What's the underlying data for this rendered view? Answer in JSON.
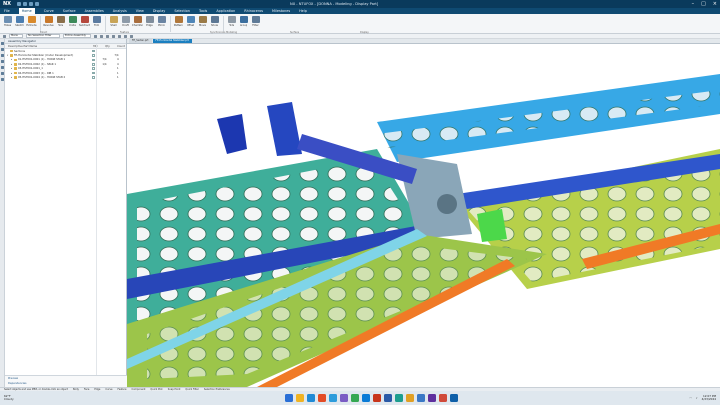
{
  "titlebar": {
    "logo": "NX",
    "title": "NX - NTUFOX - [DONNA - Modeling - Display Part]"
  },
  "menu": [
    "File",
    "Home",
    "Curve",
    "Surface",
    "Assemblies",
    "Analysis",
    "View",
    "Display",
    "Selection",
    "Tools",
    "Application",
    "Rhinoceros",
    "Milestones",
    "Help"
  ],
  "ribbon": {
    "buttons": [
      {
        "label": "Holes",
        "color": "#6c8fb3"
      },
      {
        "label": "Sketch",
        "color": "#4a7db0"
      },
      {
        "label": "Extrude",
        "color": "#d98a2b"
      },
      {
        "label": "Revolve",
        "color": "#c9782a"
      },
      {
        "label": "Hole",
        "color": "#8a6f4b"
      },
      {
        "label": "Unite",
        "color": "#3d8a5a"
      },
      {
        "label": "Subtract",
        "color": "#b5483d"
      },
      {
        "label": "Trim",
        "color": "#5a7aa0"
      },
      {
        "label": "Shell",
        "color": "#c8a456"
      },
      {
        "label": "Draft",
        "color": "#8d9aa8"
      },
      {
        "label": "Chamfer",
        "color": "#a86d3d"
      },
      {
        "label": "Edge",
        "color": "#7f8d9c"
      },
      {
        "label": "Mirror",
        "color": "#6a84a2"
      },
      {
        "label": "Pattern",
        "color": "#b0773a"
      },
      {
        "label": "Offset",
        "color": "#4f86b8"
      },
      {
        "label": "Move",
        "color": "#9a7a46"
      },
      {
        "label": "Show",
        "color": "#5c7794"
      },
      {
        "label": "Hide",
        "color": "#8c98a4"
      },
      {
        "label": "Group",
        "color": "#3b6e9e"
      },
      {
        "label": "Filter",
        "color": "#5e7a97"
      }
    ],
    "groups": [
      "Direct",
      "Feature",
      "Synchronous Modeling",
      "Surface",
      "Display"
    ]
  },
  "cmdbar": {
    "menu_label": "Menu",
    "filter_value": "No Selection Filter",
    "scope_value": "Entire Assembly"
  },
  "tabs": [
    {
      "label": "FE_Sedan.prt",
      "active": false
    },
    {
      "label": "FE-Horizontal Stabilizer.prt",
      "active": true
    }
  ],
  "navigator": {
    "title": "Assembly Navigator",
    "columns": [
      "Descriptive Part Name",
      "MO",
      "Qty",
      "Count"
    ],
    "rows": [
      {
        "label": "Sections",
        "indent": 0,
        "arrow": "",
        "qty": "",
        "count": ""
      },
      {
        "label": "FE-Horizontal Stabilizer (Under Development)",
        "indent": 0,
        "arrow": "▾",
        "qty": "",
        "count": "7/4"
      },
      {
        "label": "01-HST001-0001 (1) - HORIZ STAB 1",
        "indent": 1,
        "arrow": "▸",
        "qty": "7/4",
        "count": "4"
      },
      {
        "label": "02-HST001-0002 (1) - SPAR 1",
        "indent": 1,
        "arrow": "▸",
        "qty": "1/4",
        "count": "4"
      },
      {
        "label": "03-HST001-0001_1",
        "indent": 1,
        "arrow": "▸",
        "qty": "",
        "count": "1"
      },
      {
        "label": "04-HST001-0003 (1) - RIB 1",
        "indent": 1,
        "arrow": "▸",
        "qty": "",
        "count": "1"
      },
      {
        "label": "05-HST001-0004 (1) - HORIZ STAB 2",
        "indent": 1,
        "arrow": "▸",
        "qty": "",
        "count": "1"
      }
    ],
    "bottom": [
      "Preview",
      "Dependencies"
    ]
  },
  "status": [
    "Select objects and use MB3, or double-click an object",
    "Body",
    "Face",
    "Edge",
    "Curve",
    "Feature",
    "Component",
    "Quick Pick",
    "Snap Point",
    "Quick Filter",
    "Selection Preferences"
  ],
  "taskbar": {
    "temp": "62°F",
    "weather": "Cloudy",
    "time": "12:07 PM",
    "date": "4/23/2024",
    "apps": [
      "#2a6fd6",
      "#f0b323",
      "#1f8ad6",
      "#e34c26",
      "#2d9cdb",
      "#7a5cc4",
      "#35a853",
      "#0a7bd6",
      "#c8351b",
      "#2a5aa7",
      "#1d9e8f",
      "#e1a024",
      "#3a78c6",
      "#5e2f9e",
      "#d04a3a",
      "#0f5fa8"
    ]
  }
}
